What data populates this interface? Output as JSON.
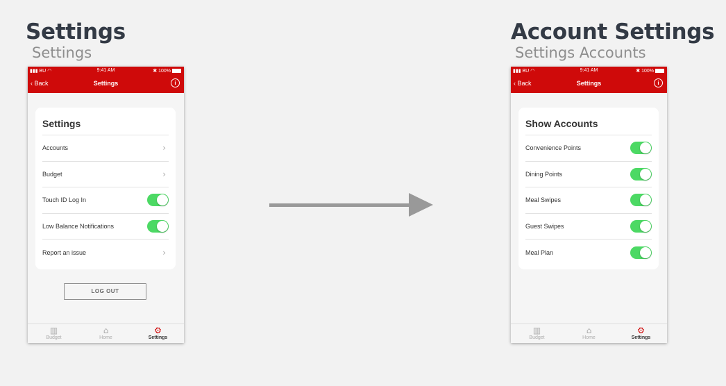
{
  "left": {
    "title": "Settings",
    "subtitle": "Settings",
    "status": {
      "carrier": "BU",
      "time": "9:41 AM",
      "battery": "100%"
    },
    "nav": {
      "back": "Back",
      "title": "Settings",
      "info": "i"
    },
    "card_title": "Settings",
    "rows": [
      {
        "label": "Accounts",
        "control": "chevron"
      },
      {
        "label": "Budget",
        "control": "chevron"
      },
      {
        "label": "Touch ID Log In",
        "control": "toggle",
        "on": true
      },
      {
        "label": "Low Balance Notifications",
        "control": "toggle",
        "on": true
      },
      {
        "label": "Report an issue",
        "control": "chevron"
      }
    ],
    "logout": "LOG OUT",
    "tabs": [
      {
        "label": "Budget",
        "icon": "chart-icon"
      },
      {
        "label": "Home",
        "icon": "home-icon"
      },
      {
        "label": "Settings",
        "icon": "gear-icon",
        "active": true
      }
    ]
  },
  "right": {
    "title": "Account Settings",
    "subtitle": "Settings Accounts",
    "status": {
      "carrier": "BU",
      "time": "9:41 AM",
      "battery": "100%"
    },
    "nav": {
      "back": "Back",
      "title": "Settings",
      "info": "i"
    },
    "card_title": "Show Accounts",
    "rows": [
      {
        "label": "Convenience Points",
        "control": "toggle",
        "on": true
      },
      {
        "label": "Dining Points",
        "control": "toggle",
        "on": true
      },
      {
        "label": "Meal Swipes",
        "control": "toggle",
        "on": true
      },
      {
        "label": "Guest Swipes",
        "control": "toggle",
        "on": true
      },
      {
        "label": "Meal Plan",
        "control": "toggle",
        "on": true
      }
    ],
    "tabs": [
      {
        "label": "Budget",
        "icon": "chart-icon"
      },
      {
        "label": "Home",
        "icon": "home-icon"
      },
      {
        "label": "Settings",
        "icon": "gear-icon",
        "active": true
      }
    ]
  },
  "colors": {
    "header_red": "#cf0a0a",
    "toggle_green": "#4cd964",
    "arrow_gray": "#999999"
  }
}
